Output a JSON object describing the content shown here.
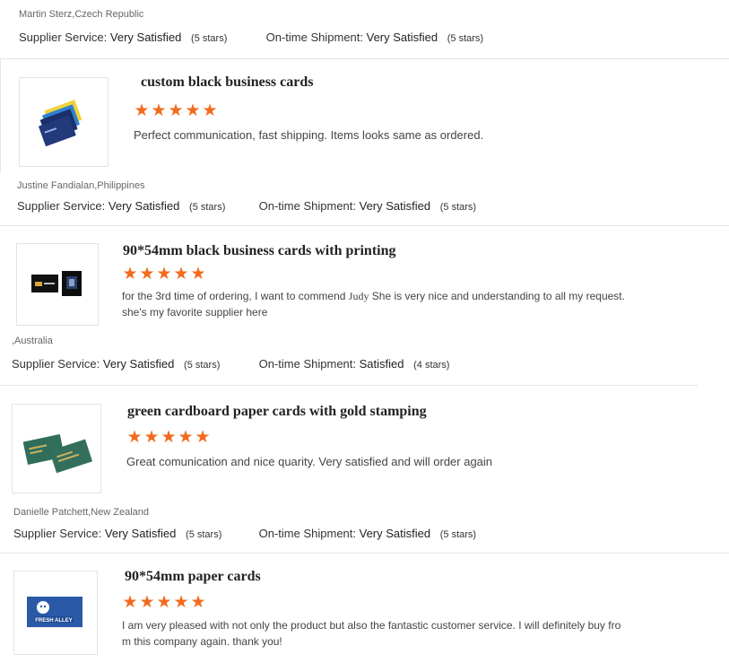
{
  "reviews": [
    {
      "reviewer": "Martin Sterz,Czech Republic",
      "supplier_label": "Supplier Service:",
      "supplier_value": "Very Satisfied",
      "supplier_stars": "(5 stars)",
      "shipment_label": "On-time Shipment:",
      "shipment_value": "Very Satisfied",
      "shipment_stars": "(5 stars)"
    },
    {
      "title": "custom black business cards",
      "rating": 5,
      "comment": "Perfect communication, fast shipping. Items looks same as ordered.",
      "reviewer": "Justine Fandialan,Philippines",
      "supplier_label": "Supplier Service:",
      "supplier_value": "Very Satisfied",
      "supplier_stars": "(5 stars)",
      "shipment_label": "On-time Shipment:",
      "shipment_value": "Very Satisfied",
      "shipment_stars": "(5 stars)"
    },
    {
      "title": "90*54mm black business cards with printing",
      "rating": 5,
      "comment_part1": "for the 3rd time of ordering, I want to commend ",
      "comment_name": "Judy",
      "comment_part2": " She is very nice and understanding to all my request.",
      "comment_line2": "she's my favorite supplier here",
      "reviewer": ",Australia",
      "supplier_label": "Supplier Service:",
      "supplier_value": "Very Satisfied",
      "supplier_stars": "(5 stars)",
      "shipment_label": "On-time Shipment:",
      "shipment_value": "Satisfied",
      "shipment_stars": "(4 stars)"
    },
    {
      "title": "green cardboard paper cards with gold stamping",
      "rating": 5,
      "comment": "Great comunication and nice quarity. Very satisfied and will order again",
      "reviewer": "Danielle Patchett,New Zealand",
      "supplier_label": "Supplier Service:",
      "supplier_value": "Very Satisfied",
      "supplier_stars": "(5 stars)",
      "shipment_label": "On-time Shipment:",
      "shipment_value": "Very Satisfied",
      "shipment_stars": "(5 stars)"
    },
    {
      "title": "90*54mm paper cards",
      "rating": 5,
      "comment_line1": "I am very pleased with not only the product but also the fantastic customer service. I will definitely buy fro",
      "comment_line2": "m this company again. thank you!",
      "card_text": "FRESH ALLEY"
    }
  ],
  "star_color": "#f26b1d",
  "star_glyph": "★"
}
